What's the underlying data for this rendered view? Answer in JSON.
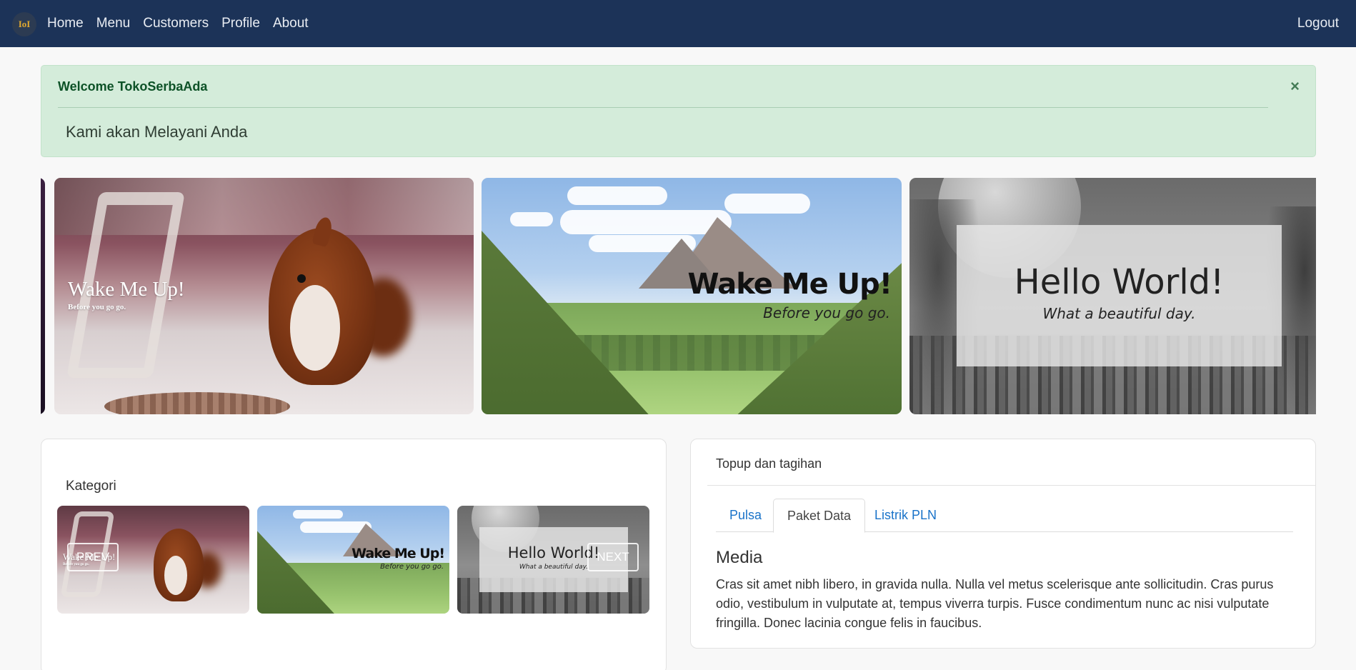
{
  "navbar": {
    "logo_text": "IoI",
    "items": [
      {
        "label": "Home"
      },
      {
        "label": "Menu"
      },
      {
        "label": "Customers"
      },
      {
        "label": "Profile"
      },
      {
        "label": "About"
      }
    ],
    "logout_label": "Logout",
    "background": "#1c3358"
  },
  "alert": {
    "title": "Welcome TokoSerbaAda",
    "close_label": "×",
    "message": "Kami akan Melayani Anda",
    "background": "#d4ecda"
  },
  "carousel": {
    "slides": [
      {
        "title": "Wake Me Up!",
        "subtitle": "Before you go go."
      },
      {
        "title": "Wake Me Up!",
        "subtitle": "Before you go go."
      },
      {
        "title": "Hello World!",
        "subtitle": "What a beautiful day."
      }
    ]
  },
  "kategori": {
    "title": "Kategori",
    "prev_label": "PREV",
    "next_label": "NEXT",
    "thumbs": [
      {
        "title": "Wake Me Up!",
        "subtitle": "Before you go go."
      },
      {
        "title": "Wake Me Up!",
        "subtitle": "Before you go go."
      },
      {
        "title": "Hello World!",
        "subtitle": "What a beautiful day."
      }
    ]
  },
  "topup": {
    "title": "Topup dan tagihan",
    "tabs": [
      {
        "label": "Pulsa"
      },
      {
        "label": "Paket Data"
      },
      {
        "label": "Listrik PLN"
      }
    ],
    "active_tab": "Paket Data",
    "content_heading": "Media",
    "content_body": "Cras sit amet nibh libero, in gravida nulla. Nulla vel metus scelerisque ante sollicitudin. Cras purus odio, vestibulum in vulputate at, tempus viverra turpis. Fusce condimentum nunc ac nisi vulputate fringilla. Donec lacinia congue felis in faucibus."
  }
}
